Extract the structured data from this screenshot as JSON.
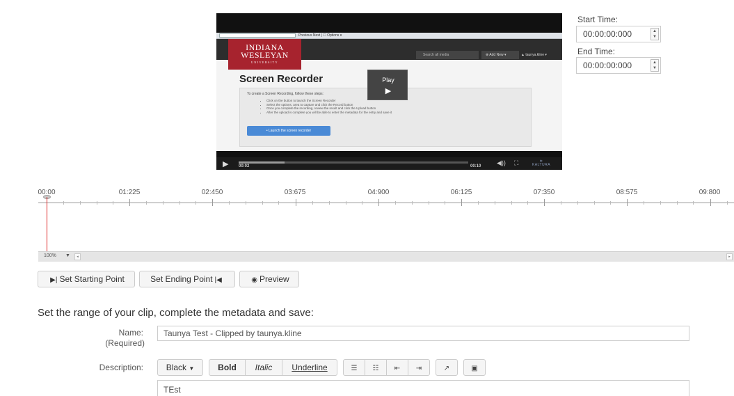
{
  "player": {
    "embedded_page": {
      "url_bar_tail": "Previous  Next  |  ☐ Options ▾",
      "logo_line1": "INDIANA",
      "logo_line2": "WESLEYAN",
      "logo_line3": "UNIVERSITY",
      "search_placeholder": "Search all media",
      "add_new": "⊕ Add New ▾",
      "user": "▲ taunya.kline ▾",
      "title": "Screen Recorder",
      "intro": "To create a Screen Recording, follow these steps:",
      "steps": [
        "Click on the button to launch the Screen Recorder",
        "Select the options, area to capture and click the Record button",
        "Once you complete the recording, review the result and click the Upload button",
        "After the upload is complete you will be able to enter the metadata for the entry and save it"
      ],
      "launch_button": "• Launch the screen recorder"
    },
    "overlay_label": "Play",
    "overlay_glyph": "▶",
    "play_glyph": "▶",
    "current_time": "00:02",
    "duration": "00:10",
    "progress_fraction": 0.2,
    "volume_glyph": "◀))",
    "fullscreen_glyph": "⛶",
    "brand": "KALTURA"
  },
  "trim": {
    "start_label": "Start Time:",
    "start_value": "00:00:00:000",
    "end_label": "End Time:",
    "end_value": "00:00:00:000"
  },
  "timeline": {
    "ticks": [
      "00:00",
      "01:225",
      "02:450",
      "03:675",
      "04:900",
      "06:125",
      "07:350",
      "08:575",
      "09:800"
    ],
    "zoom": "100%",
    "zoom_caret": "▼",
    "scroll_left": "◂",
    "scroll_right": "▸"
  },
  "buttons": {
    "set_start": "Set Starting Point",
    "set_end": "Set Ending Point",
    "preview": "Preview"
  },
  "form": {
    "heading": "Set the range of your clip, complete the metadata and save:",
    "name_label": "Name:",
    "name_required": "(Required)",
    "name_value": "Taunya Test - Clipped by taunya.kline",
    "description_label": "Description:",
    "toolbar": {
      "color": "Black",
      "bold": "Bold",
      "italic": "Italic",
      "underline": "Underline"
    },
    "description_value": "TEst"
  },
  "colors": {
    "accent_red": "#a7232e",
    "cursor_red": "#dd2222"
  }
}
